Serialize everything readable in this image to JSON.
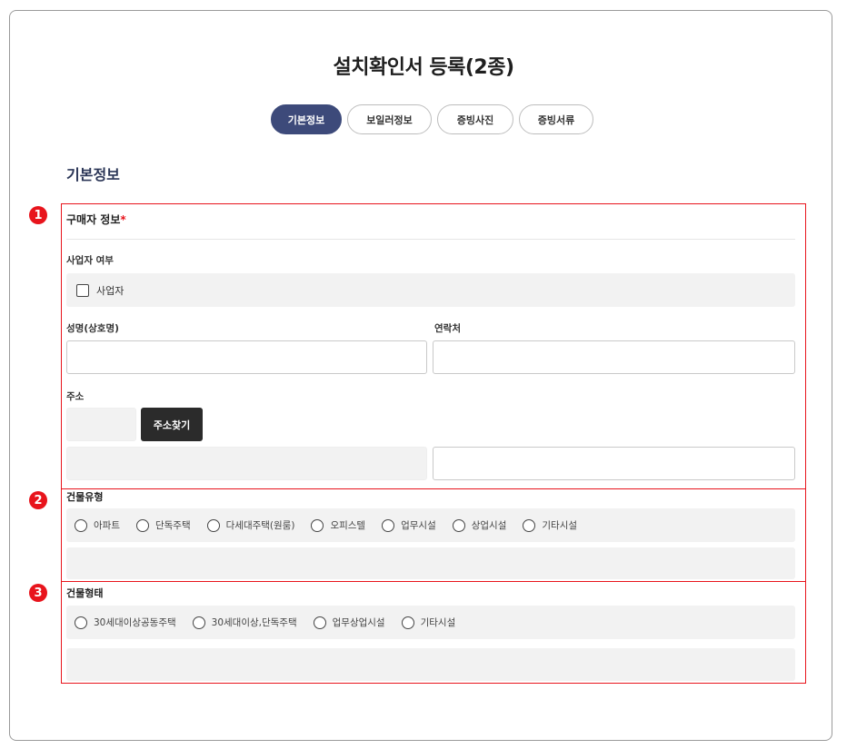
{
  "page": {
    "title": "설치확인서 등록(2종)"
  },
  "tabs": [
    {
      "label": "기본정보",
      "active": true
    },
    {
      "label": "보일러정보",
      "active": false
    },
    {
      "label": "증빙사진",
      "active": false
    },
    {
      "label": "증빙서류",
      "active": false
    }
  ],
  "section": {
    "heading": "기본정보"
  },
  "markers": [
    "1",
    "2",
    "3"
  ],
  "buyer": {
    "title": "구매자 정보",
    "required_mark": "*",
    "business_label": "사업자 여부",
    "business_checkbox": "사업자",
    "name_label": "성명(상호명)",
    "contact_label": "연락처",
    "address_label": "주소",
    "address_search_button": "주소찾기"
  },
  "building_type": {
    "title": "건물유형",
    "options": [
      "아파트",
      "단독주택",
      "다세대주택(원룸)",
      "오피스텔",
      "업무시설",
      "상업시설",
      "기타시설"
    ]
  },
  "building_form": {
    "title": "건물형태",
    "options": [
      "30세대이상공동주택",
      "30세대이상,단독주택",
      "업무상업시설",
      "기타시설"
    ]
  },
  "colors": {
    "accent": "#3d4a7a",
    "highlight": "#e8141c",
    "field_gray": "#f2f2f2",
    "button_dark": "#2b2b2b"
  }
}
